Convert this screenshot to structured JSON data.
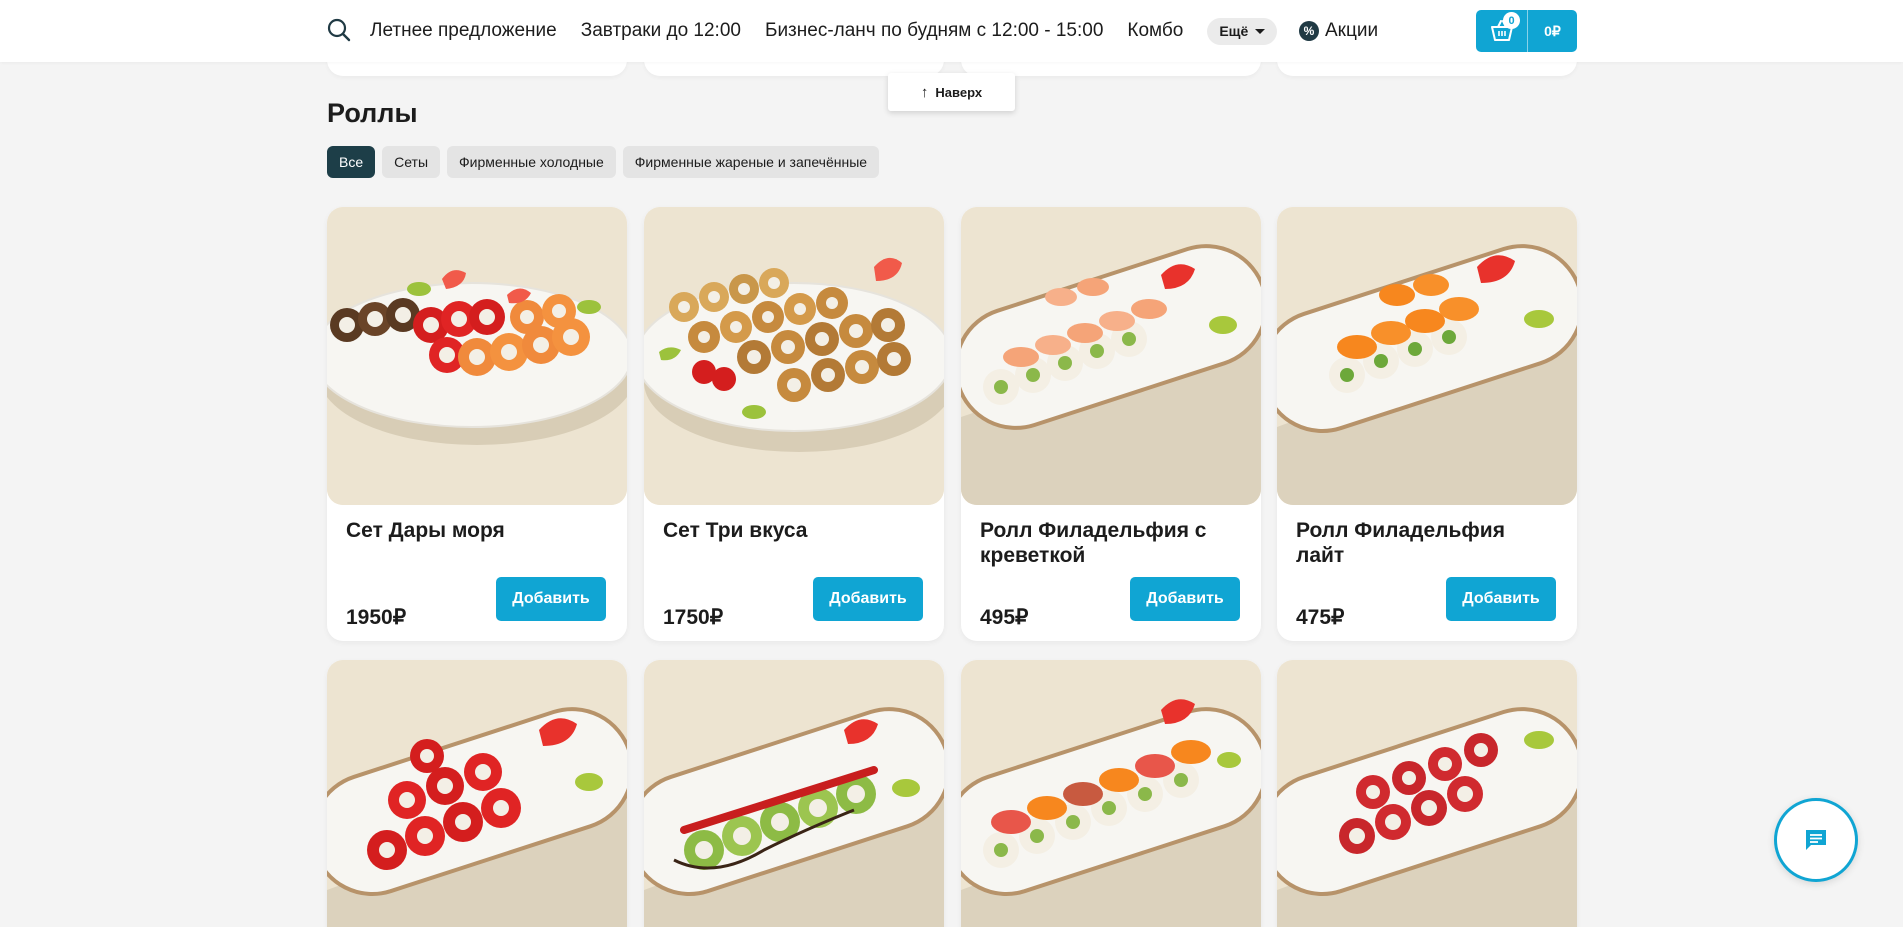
{
  "header": {
    "nav": [
      "Летнее предложение",
      "Завтраки до 12:00",
      "Бизнес-ланч по будням с 12:00 - 15:00",
      "Комбо"
    ],
    "more_label": "Ещё",
    "promo_label": "Акции",
    "cart_count": "0",
    "cart_sum": "0₽"
  },
  "to_top_label": "Наверх",
  "section": {
    "title": "Роллы",
    "filters": [
      "Все",
      "Сеты",
      "Фирменные холодные",
      "Фирменные жареные и запечённые"
    ],
    "active_filter": "Все"
  },
  "products": [
    {
      "name": "Сет Дары моря",
      "price": "1950₽",
      "button": "Добавить"
    },
    {
      "name": "Сет Три вкуса",
      "price": "1750₽",
      "button": "Добавить"
    },
    {
      "name": "Ролл Филадельфия с креветкой",
      "price": "495₽",
      "button": "Добавить"
    },
    {
      "name": "Ролл Филадельфия лайт",
      "price": "475₽",
      "button": "Добавить"
    }
  ],
  "colors": {
    "accent": "#10a5d3",
    "active_chip": "#1d3e48",
    "image_bg": "#ede4d1"
  },
  "icons": {
    "search": "search-icon",
    "promo": "percent-icon",
    "cart": "basket-icon",
    "to_top": "arrow-up-icon",
    "chat": "chat-icon"
  }
}
